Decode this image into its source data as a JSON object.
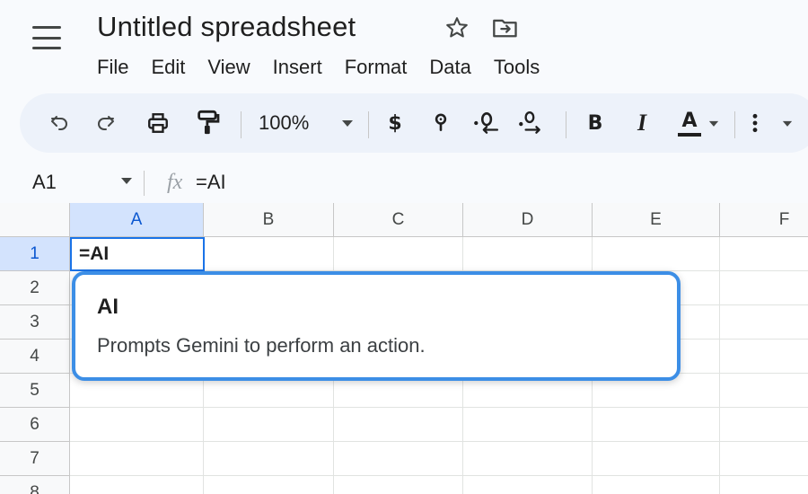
{
  "header": {
    "title": "Untitled spreadsheet",
    "star_icon": "star-icon",
    "move_icon": "move-to-folder-icon",
    "menu": [
      "File",
      "Edit",
      "View",
      "Insert",
      "Format",
      "Data",
      "Tools"
    ]
  },
  "toolbar": {
    "undo_icon": "undo-icon",
    "redo_icon": "redo-icon",
    "print_icon": "print-icon",
    "paint_format_icon": "paint-format-icon",
    "zoom": "100%",
    "currency_label": "$",
    "percent_icon": "percent-icon",
    "decrease_decimal_icon": "decrease-decimal-icon",
    "increase_decimal_icon": "increase-decimal-icon",
    "bold_label": "B",
    "italic_label": "I",
    "text_color_label": "A",
    "more_icon": "more-vert-icon"
  },
  "formula_bar": {
    "cell_ref": "A1",
    "fx_label": "fx",
    "value": "=AI"
  },
  "grid": {
    "columns": [
      "A",
      "B",
      "C",
      "D",
      "E",
      "F"
    ],
    "rows": [
      "1",
      "2",
      "3",
      "4",
      "5",
      "6",
      "7",
      "8"
    ],
    "selected_column": "A",
    "selected_row": "1",
    "active_cell_value": "=AI"
  },
  "autocomplete": {
    "function_name": "AI",
    "description": "Prompts Gemini to perform an action."
  },
  "colors": {
    "accent": "#1a73e8",
    "popup_border": "#3c8ee6",
    "toolbar_bg": "#edf2fa",
    "header_selected": "#d3e3fd"
  }
}
